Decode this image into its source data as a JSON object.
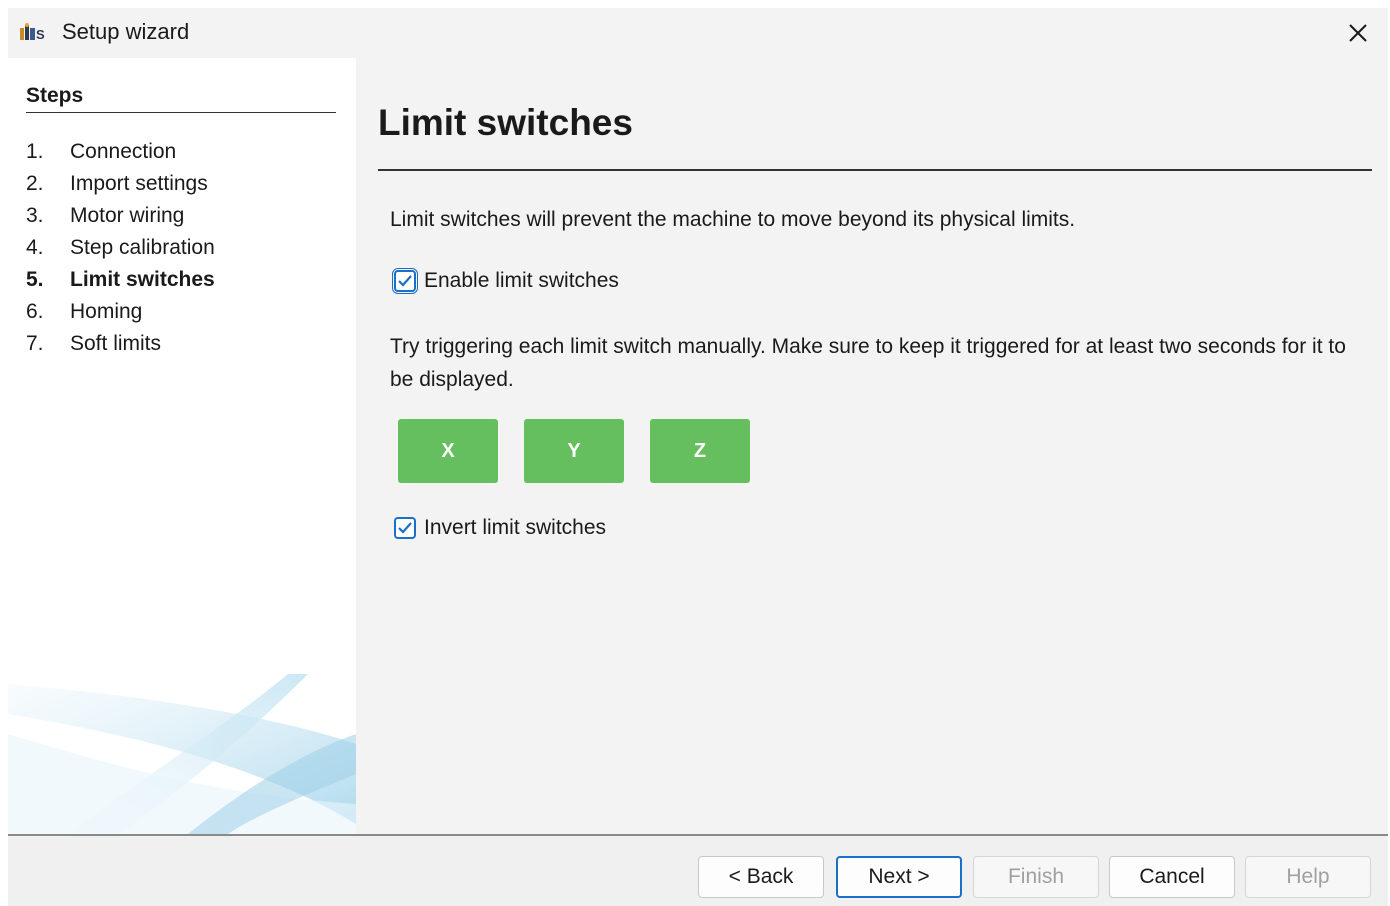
{
  "window": {
    "title": "Setup wizard",
    "app_icon": "ugs-logo-icon",
    "close_icon": "close-icon"
  },
  "sidebar": {
    "heading": "Steps",
    "steps": [
      {
        "number": "1.",
        "label": "Connection",
        "active": false
      },
      {
        "number": "2.",
        "label": "Import settings",
        "active": false
      },
      {
        "number": "3.",
        "label": "Motor wiring",
        "active": false
      },
      {
        "number": "4.",
        "label": "Step calibration",
        "active": false
      },
      {
        "number": "5.",
        "label": "Limit switches",
        "active": true
      },
      {
        "number": "6.",
        "label": "Homing",
        "active": false
      },
      {
        "number": "7.",
        "label": "Soft limits",
        "active": false
      }
    ]
  },
  "main": {
    "title": "Limit switches",
    "intro": "Limit switches will prevent the machine to move beyond its physical limits.",
    "enable_checkbox": {
      "label": "Enable limit switches",
      "checked": true
    },
    "instructions": "Try triggering each limit switch manually. Make sure to keep it triggered for at least two seconds for it to be displayed.",
    "axes": [
      {
        "label": "X",
        "color": "#66bf5e"
      },
      {
        "label": "Y",
        "color": "#66bf5e"
      },
      {
        "label": "Z",
        "color": "#66bf5e"
      }
    ],
    "invert_checkbox": {
      "label": "Invert limit switches",
      "checked": true
    }
  },
  "footer": {
    "back_label": "< Back",
    "next_label": "Next >",
    "finish_label": "Finish",
    "cancel_label": "Cancel",
    "help_label": "Help"
  },
  "colors": {
    "accent": "#1a6fc9",
    "axis_green": "#66bf5e"
  }
}
